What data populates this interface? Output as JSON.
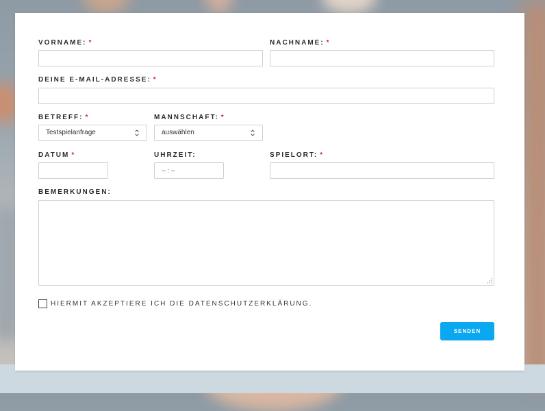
{
  "form": {
    "required_mark": "*",
    "vorname": {
      "label": "VORNAME:",
      "value": ""
    },
    "nachname": {
      "label": "NACHNAME:",
      "value": ""
    },
    "email": {
      "label": "DEINE E-MAIL-ADRESSE:",
      "value": ""
    },
    "betreff": {
      "label": "BETREFF:",
      "selected": "Testspielanfrage"
    },
    "mannschaft": {
      "label": "MANNSCHAFT:",
      "selected": "auswählen"
    },
    "datum": {
      "label": "DATUM",
      "value": ""
    },
    "uhrzeit": {
      "label": "UHRZEIT:",
      "value": "-- : --"
    },
    "spielort": {
      "label": "SPIELORT:",
      "value": ""
    },
    "bemerkungen": {
      "label": "BEMERKUNGEN:",
      "value": ""
    },
    "consent": {
      "label": "HIERMIT AKZEPTIERE ICH DIE DATENSCHUTZERKLÄRUNG.",
      "checked": false
    },
    "submit_label": "SENDEN"
  },
  "colors": {
    "accent": "#0aa8f0",
    "required": "#d9232e",
    "border": "#cfcfcf"
  }
}
